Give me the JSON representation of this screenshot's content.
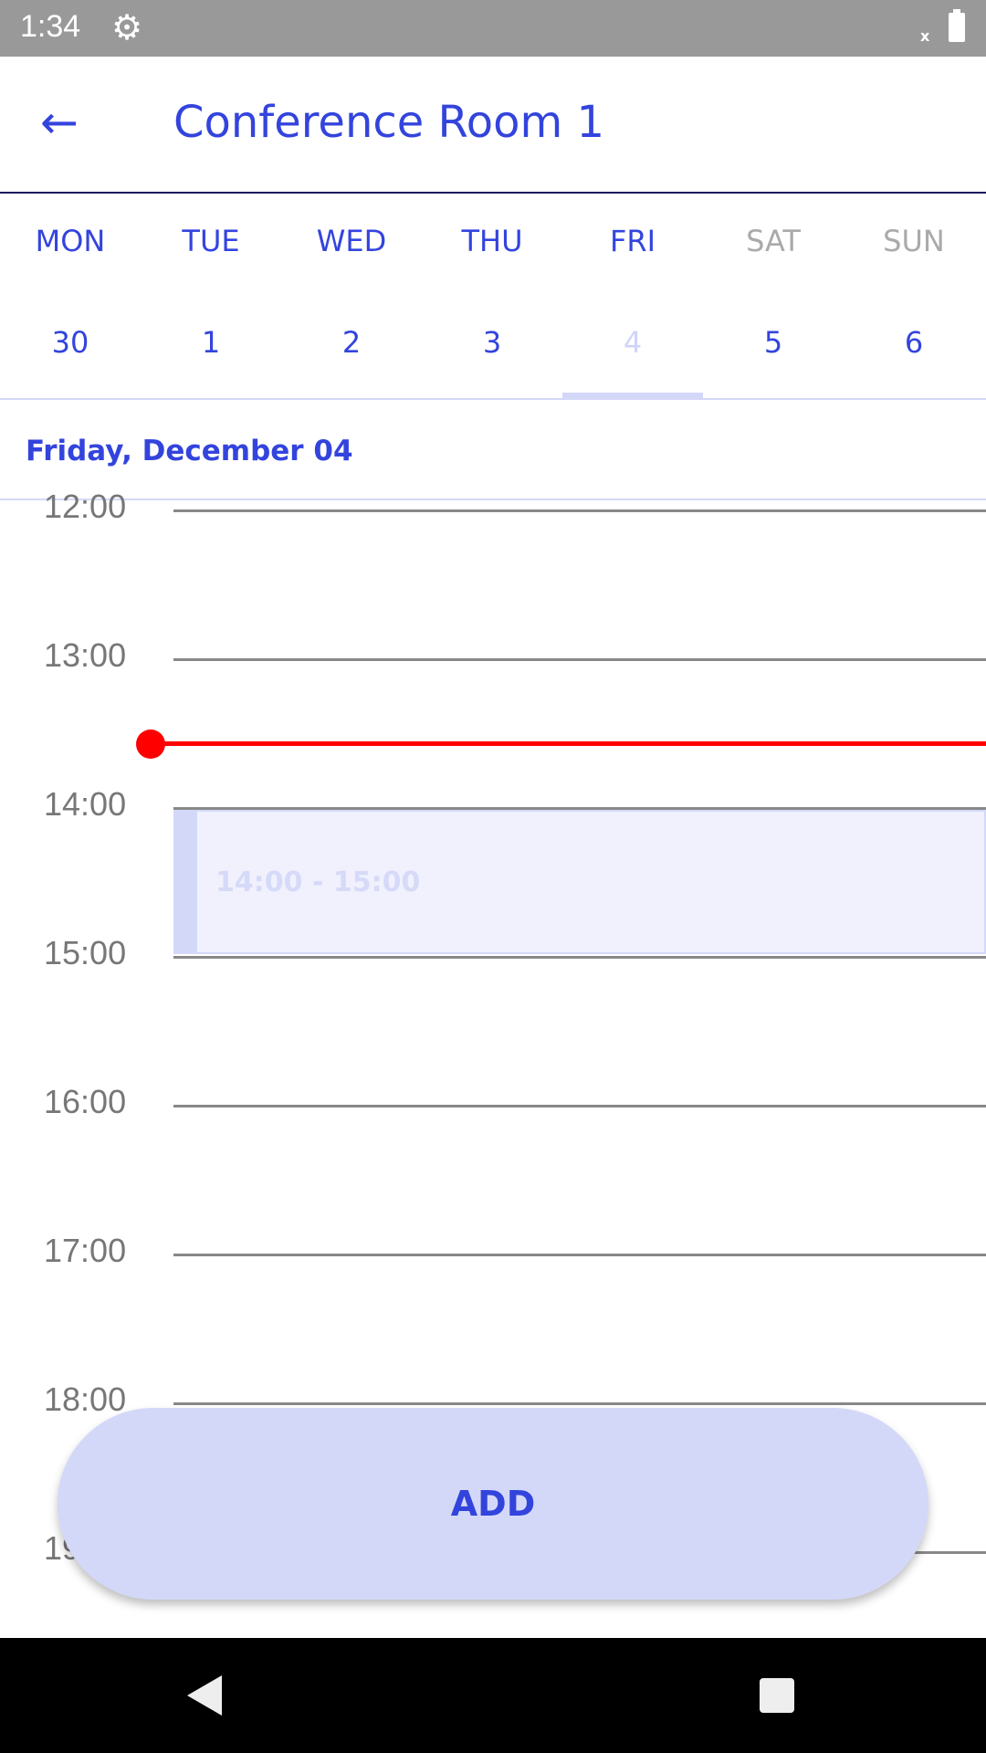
{
  "status_bar": {
    "time": "1:34",
    "icons": [
      "gear-icon",
      "no-signal-x",
      "battery-icon"
    ]
  },
  "header": {
    "title": "Conference Room 1",
    "back_icon": "arrow-back-icon"
  },
  "week": [
    {
      "day": "MON",
      "date": "30",
      "weekend": false
    },
    {
      "day": "TUE",
      "date": "1",
      "weekend": false
    },
    {
      "day": "WED",
      "date": "2",
      "weekend": false
    },
    {
      "day": "THU",
      "date": "3",
      "weekend": false
    },
    {
      "day": "FRI",
      "date": "4",
      "weekend": false,
      "selected": true
    },
    {
      "day": "SAT",
      "date": "5",
      "weekend": true
    },
    {
      "day": "SUN",
      "date": "6",
      "weekend": true
    }
  ],
  "selected_date_label": "Friday, December 04",
  "hours": [
    "12:00",
    "13:00",
    "14:00",
    "15:00",
    "16:00",
    "17:00",
    "18:00",
    "19:00"
  ],
  "current_time": "13:34",
  "events": [
    {
      "label": "14:00 - 15:00",
      "start": "14:00",
      "end": "15:00"
    }
  ],
  "add_button": "ADD",
  "colors": {
    "accent": "#3344dd",
    "light_accent": "#d4d8f8",
    "now_line": "#ff0000"
  }
}
